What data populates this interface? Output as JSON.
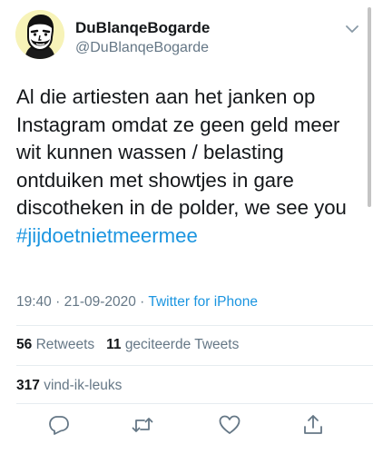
{
  "user": {
    "display_name": "DuBlanqeBogarde",
    "handle": "@DuBlanqeBogarde"
  },
  "tweet": {
    "body": "Al die artiesten aan het janken op Instagram omdat ze geen geld meer wit kunnen wassen / belasting ontduiken met showtjes in gare discotheken in de polder, we see you",
    "hashtag": "#jijdoetnietmeermee",
    "time": "19:40",
    "separator": " · ",
    "date": "21-09-2020",
    "source": "Twitter for iPhone"
  },
  "stats": {
    "retweets_count": "56",
    "retweets_label": "Retweets",
    "quote_count": "11",
    "quote_label": "geciteerde Tweets",
    "likes_count": "317",
    "likes_label": "vind-ik-leuks"
  },
  "icons": {
    "reply": "reply-icon",
    "retweet": "retweet-icon",
    "like": "heart-icon",
    "share": "share-icon",
    "menu": "chevron-down-icon"
  },
  "colors": {
    "link": "#1b95e0",
    "secondary": "#657786",
    "primary": "#14171a",
    "divider": "#e6ecf0",
    "avatar_bg": "#f7f3b8"
  }
}
